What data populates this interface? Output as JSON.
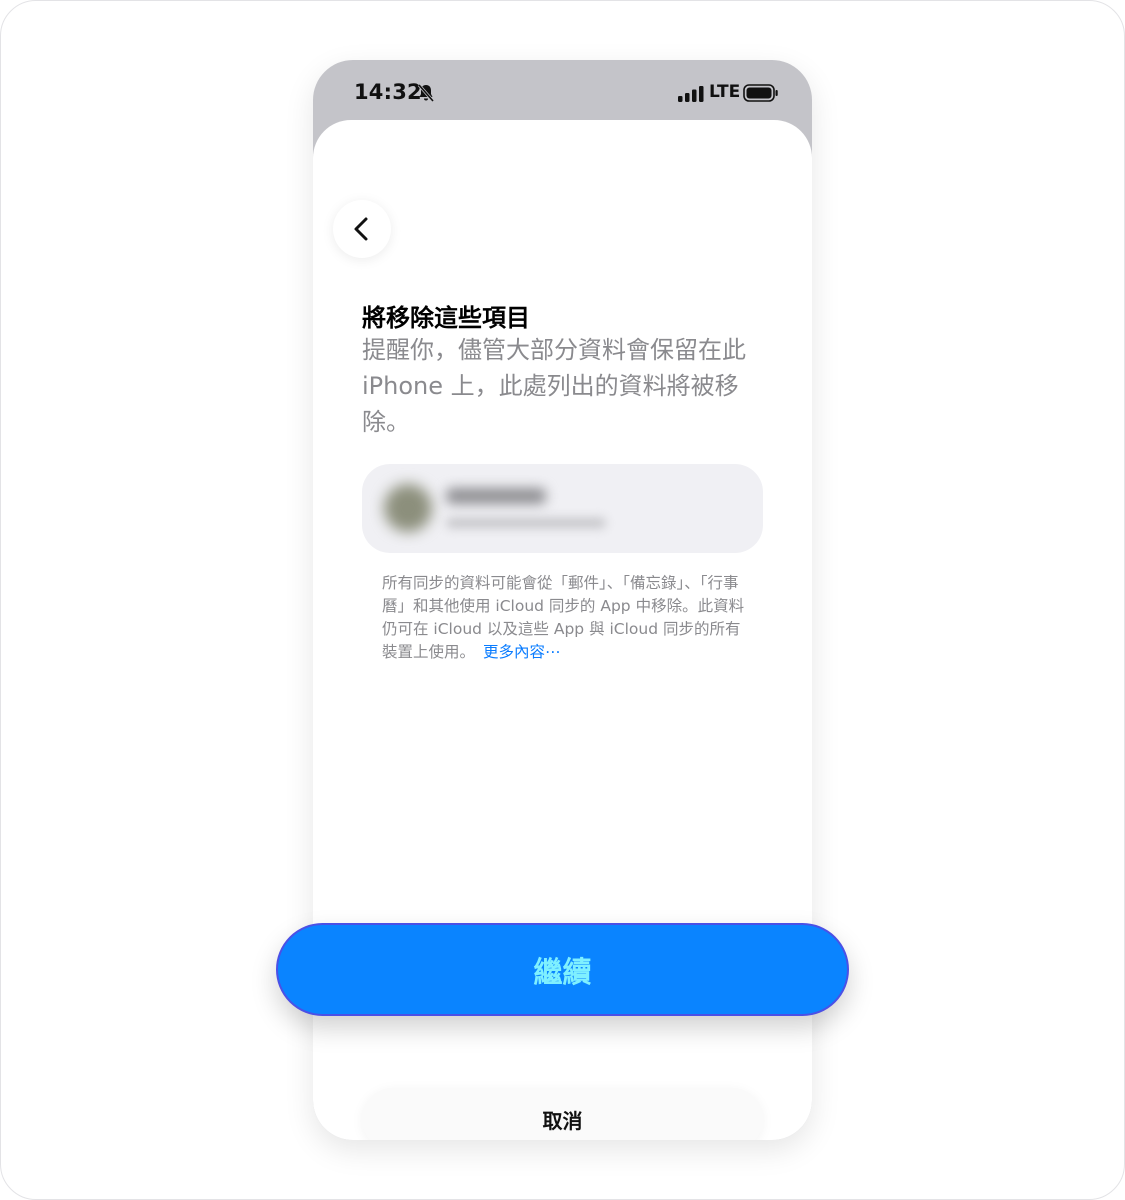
{
  "status_bar": {
    "time": "14:32",
    "network": "LTE",
    "icons": [
      "bell-slash-icon",
      "signal-bars-icon",
      "battery-icon"
    ]
  },
  "sheet": {
    "heading": "將移除這些項目",
    "description": "提醒你，儘管大部分資料會保留在此 iPhone 上，此處列出的資料將被移除。",
    "note": "所有同步的資料可能會從「郵件」、「備忘錄」、「行事曆」和其他使用 iCloud 同步的 App 中移除。此資料仍可在 iCloud 以及這些 App 與 iCloud 同步的所有裝置上使用。",
    "more_link": "更多內容⋯",
    "back_icon": "chevron-left-icon"
  },
  "actions": {
    "continue_label": "繼續",
    "cancel_label": "取消"
  },
  "colors": {
    "accent": "#0a84ff",
    "link": "#0a7cff",
    "continue_text": "#7ff0ff",
    "status_bar_bg": "#c4c4c9"
  }
}
